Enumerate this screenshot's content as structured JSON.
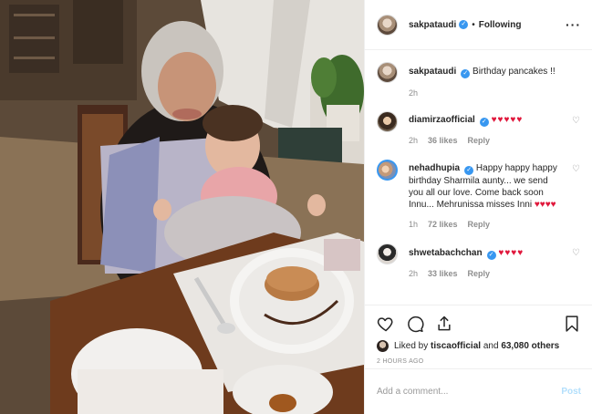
{
  "post": {
    "username": "sakpataudi",
    "follow_status": "Following",
    "more_icon": "more-options-icon"
  },
  "caption": {
    "username": "sakpataudi",
    "text": "Birthday pancakes !!",
    "time": "2h"
  },
  "comments": [
    {
      "username": "diamirzaofficial",
      "text": "♥♥♥♥♥",
      "time": "2h",
      "likes": "36 likes",
      "reply": "Reply"
    },
    {
      "username": "nehadhupia",
      "text": "Happy happy happy birthday Sharmila aunty... we send you all our love. Come back soon Innu... Mehrunissa misses Inni ♥♥♥♥",
      "time": "1h",
      "likes": "72 likes",
      "reply": "Reply"
    },
    {
      "username": "shwetabachchan",
      "text": "♥♥♥♥",
      "time": "2h",
      "likes": "33 likes",
      "reply": "Reply"
    }
  ],
  "likes_line": {
    "prefix": "Liked by",
    "user": "tiscaofficial",
    "and": "and",
    "count": "63,080 others"
  },
  "timestamp": "2 HOURS AGO",
  "add_comment": {
    "placeholder": "Add a comment...",
    "post_label": "Post"
  },
  "colors": {
    "verified": "#3897f0",
    "heart": "#e0173b",
    "post_button": "#b2dffc",
    "muted": "#8e8e8e"
  }
}
